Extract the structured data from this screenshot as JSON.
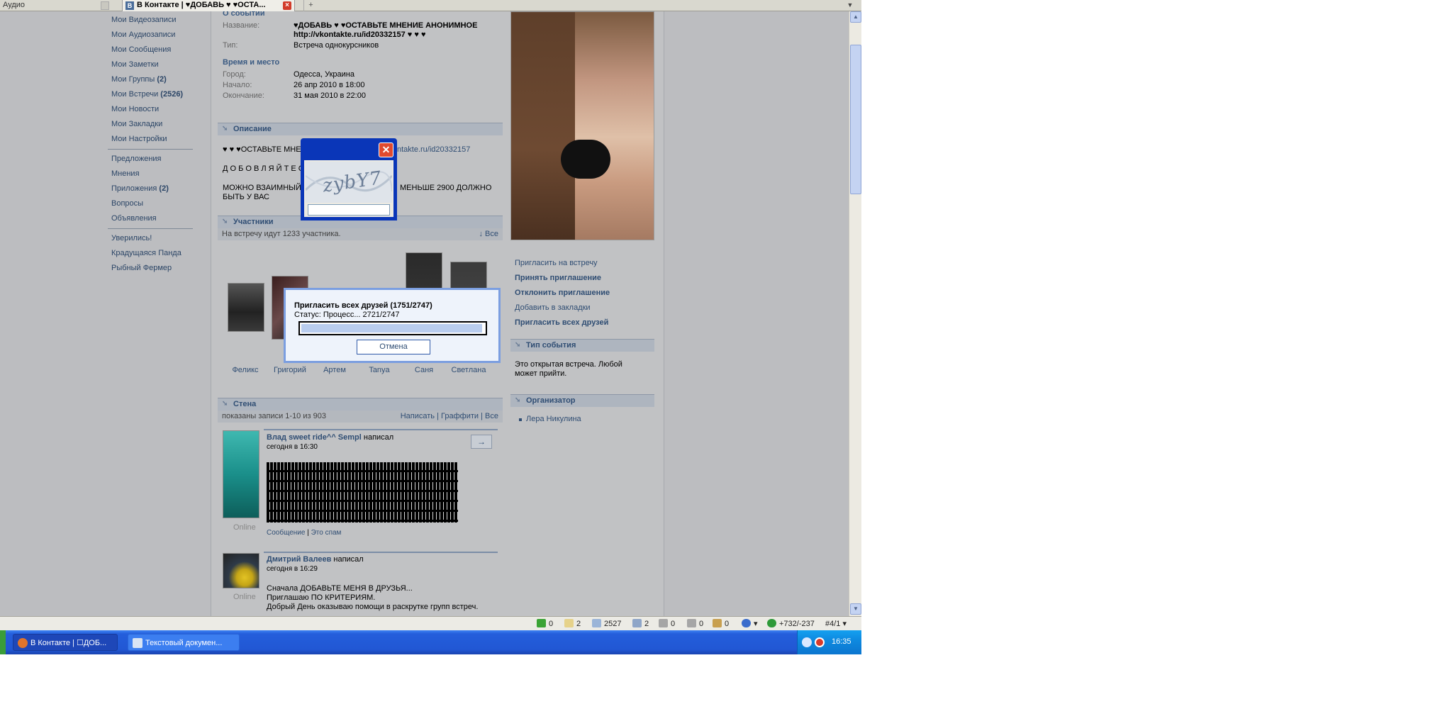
{
  "browser": {
    "tab_audio": "Аудио",
    "tab_active": "В Контакте | ♥ДОБАВЬ ♥ ♥ОСТА...",
    "tab_active_icon": "vk-icon",
    "new_tab": "+"
  },
  "left_nav": {
    "group1": [
      "Мои Видеозаписи",
      "Мои Аудиозаписи",
      "Мои Сообщения",
      "Мои Заметки"
    ],
    "groups_label": "Мои Группы",
    "groups_count": "(2)",
    "meetings_label": "Мои Встречи",
    "meetings_count": "(2526)",
    "group1b": [
      "Мои Новости",
      "Мои Закладки",
      "Мои Настройки"
    ],
    "group2": [
      "Предложения",
      "Мнения"
    ],
    "apps_label": "Приложения",
    "apps_count": "(2)",
    "group2b": [
      "Вопросы",
      "Объявления"
    ],
    "group3": [
      "Уверились!",
      "Крадущаяся Панда",
      "Рыбный Фермер"
    ]
  },
  "event": {
    "about_header": "О событии",
    "name_label": "Название:",
    "name_line1": "♥ДОБАВЬ ♥ ♥ОСТАВЬТЕ МНЕНИЕ АНОНИМНОЕ",
    "name_line2": "http://vkontakte.ru/id20332157 ♥ ♥ ♥",
    "type_label": "Тип:",
    "type_value": "Встреча однокурсников",
    "place_header": "Время и место",
    "city_label": "Город:",
    "city_value": "Одесса, Украина",
    "start_label": "Начало:",
    "start_value": "26 апр 2010 в 18:00",
    "end_label": "Окончание:",
    "end_value": "31 мая 2010 в 22:00"
  },
  "description": {
    "header": "Описание",
    "line1_left": "♥ ♥ ♥ОСТАВЬТЕ МНЕН",
    "line1_right": "ntakte.ru/id20332157",
    "line2": "Д О Б О В Л Я Й Т Е С",
    "line3_left": "МОЖНО ВЗАИМНЫЙ П",
    "line3_right": "МЕНЬШЕ 2900 ДОЛЖНО",
    "line4": "БЫТЬ У ВАС"
  },
  "members": {
    "header": "Участники",
    "count_text": "На встречу идут 1233 участника.",
    "all_link": "↓ Все",
    "names": [
      "Феликс",
      "Григорий",
      "Артем",
      "Tanya",
      "Саня",
      "Светлана"
    ]
  },
  "wall": {
    "header": "Стена",
    "shown_text": "показаны записи 1-10 из 903",
    "write_link": "Написать",
    "graffiti_link": "Граффити",
    "all_link": "Все",
    "post1": {
      "author": "Влад sweet ride^^ Sempl",
      "wrote": "написал",
      "time": "сегодня в 16:30",
      "status": "Online",
      "message_link": "Сообщение",
      "spam_link": "Это спам",
      "arrow": "→"
    },
    "post2": {
      "author": "Дмитрий Валеев",
      "wrote": "написал",
      "time": "сегодня в 16:29",
      "status": "Online",
      "line1": "Сначала ДОБАВЬТЕ МЕНЯ В ДРУЗЬЯ...",
      "line2": "Приглашаю ПО КРИТЕРИЯМ.",
      "line3": "Добрый День оказываю помощи в раскрутке групп встреч."
    }
  },
  "right_col": {
    "invite_to_meeting": "Пригласить на встречу",
    "accept": "Принять приглашение",
    "decline": "Отклонить приглашение",
    "bookmark": "Добавить в закладки",
    "invite_all": "Пригласить всех друзей",
    "event_type_header": "Тип события",
    "event_type_text1": "Это открытая встреча. Любой",
    "event_type_text2": "может прийти.",
    "organizer_header": "Организатор",
    "organizer_name": "Лера Никулина"
  },
  "captcha_dialog": {
    "captcha_text": "zybY7",
    "input_value": "",
    "close": "✕"
  },
  "invite_dialog": {
    "title": "Пригласить всех друзей (1751/2747)",
    "status": "Статус: Процесс... 2721/2747",
    "progress_fraction": 0.99,
    "cancel": "Отмена"
  },
  "status_bar": {
    "items": [
      "0",
      "2",
      "2527",
      "2",
      "0",
      "0",
      "0"
    ],
    "score": "+732/-237",
    "rank": "#4/1"
  },
  "taskbar": {
    "btn1": "В Контакте | ☐ДОБ...",
    "btn2": "Текстовый докумен...",
    "clock": "16:35"
  },
  "colors": {
    "vk_link": "#2f4d73",
    "section_bar": "#aeb5bf",
    "taskbar_blue": "#245edb"
  }
}
